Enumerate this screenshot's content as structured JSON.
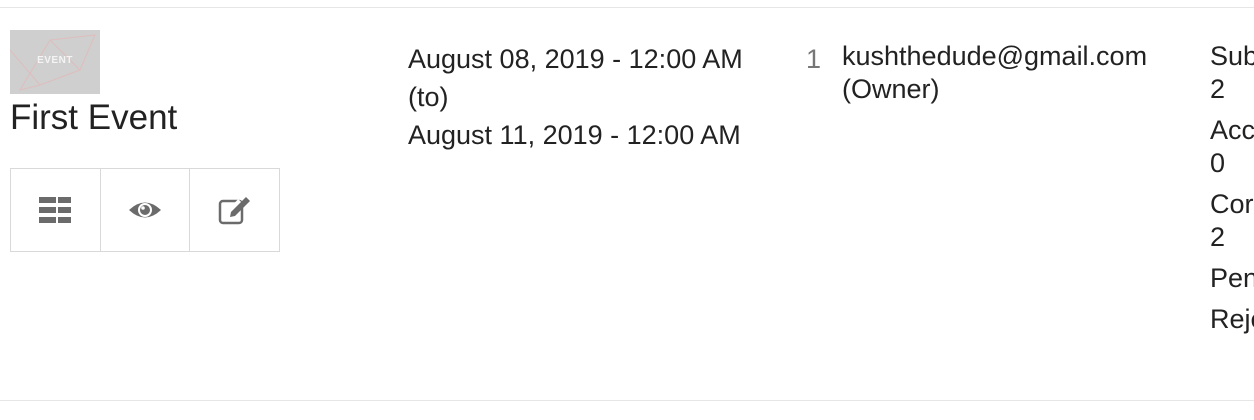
{
  "event": {
    "thumbnail_text": "EVENT",
    "title": "First Event",
    "actions": [
      {
        "icon": "list-icon"
      },
      {
        "icon": "eye-icon"
      },
      {
        "icon": "edit-icon"
      }
    ]
  },
  "dates": {
    "start": "August 08, 2019 - 12:00 AM",
    "separator": "(to)",
    "end": "August 11, 2019 - 12:00 AM"
  },
  "owner": {
    "count": "1",
    "email": "kushthedude@gmail.com",
    "role": "(Owner)"
  },
  "stats": {
    "submitted": {
      "label": "Sub",
      "value": "2"
    },
    "accepted": {
      "label": "Acc",
      "value": "0"
    },
    "confirmed": {
      "label": "Cor",
      "value": "2"
    },
    "pending": {
      "label": "Pen",
      "value": ""
    },
    "rejected": {
      "label": "Reje",
      "value": ""
    }
  },
  "colors": {
    "icon": "#6b6b6b",
    "border": "#d9d9d9",
    "thumbnail": "#cfcfcf"
  }
}
